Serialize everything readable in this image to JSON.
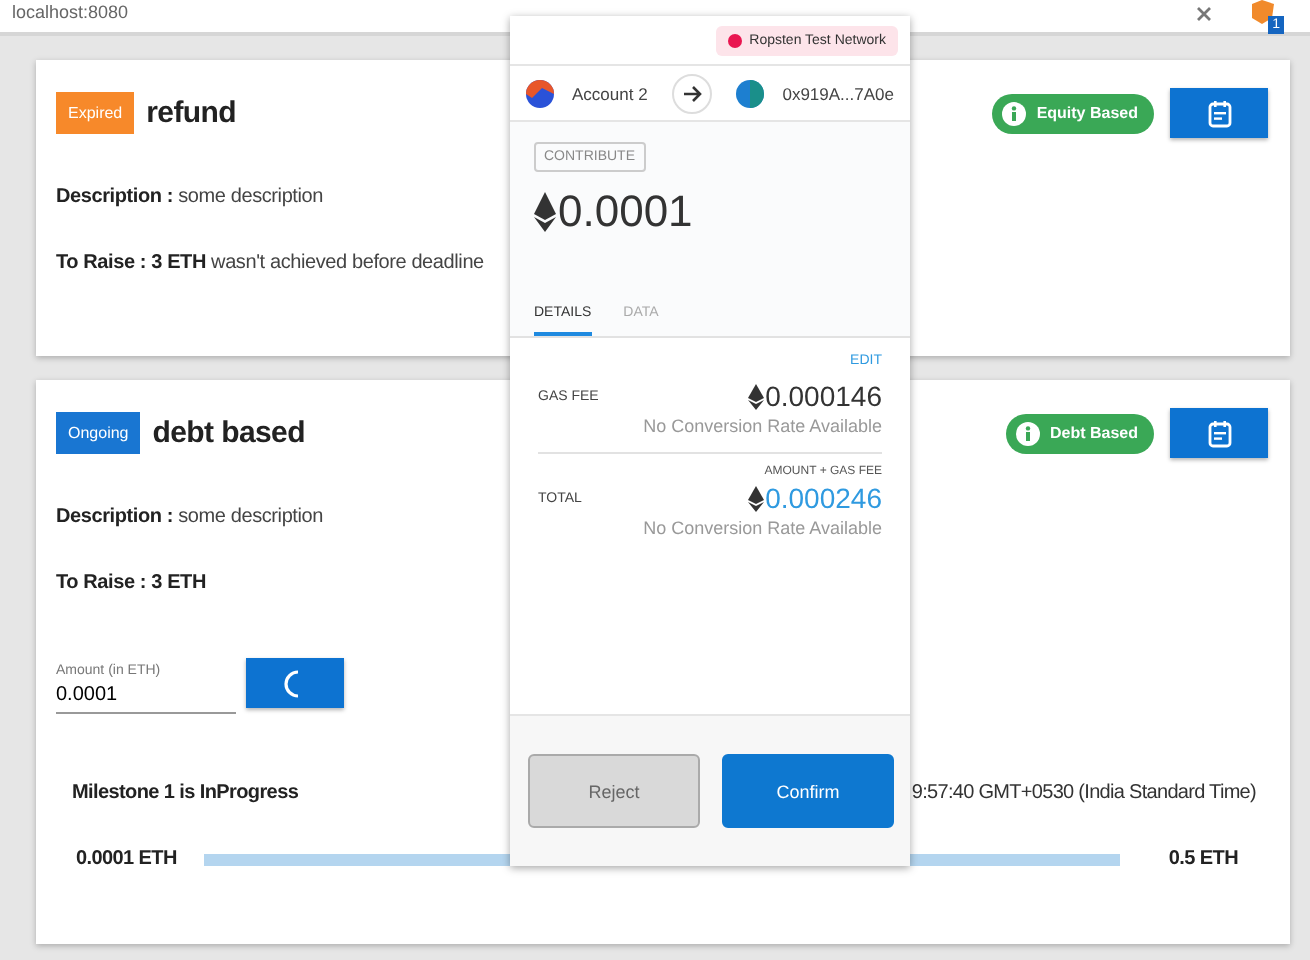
{
  "browser": {
    "url": "localhost:8080",
    "extension_badge": "1"
  },
  "campaigns": [
    {
      "status": {
        "label": "Expired",
        "kind": "expired"
      },
      "title": "refund",
      "type_chip": "Equity Based",
      "description_label": "Description :",
      "description": "some description",
      "raise_label": "To Raise : 3 ETH",
      "raise_note": "wasn't achieved before deadline"
    },
    {
      "status": {
        "label": "Ongoing",
        "kind": "ongoing"
      },
      "title": "debt based",
      "type_chip": "Debt Based",
      "description_label": "Description :",
      "description": "some description",
      "raise_label": "To Raise : 3 ETH",
      "contribute": {
        "label": "Amount (in ETH)",
        "value": "0.0001",
        "loading": true
      },
      "milestone": {
        "text": "Milestone 1 is InProgress",
        "date": "9:57:40 GMT+0530 (India Standard Time)",
        "min": "0.0001 ETH",
        "max": "0.5 ETH",
        "level": 1
      }
    }
  ],
  "confirm": {
    "network": "Ropsten Test Network",
    "from": "Account 2",
    "to": "0x919A...7A0e",
    "method": "CONTRIBUTE",
    "amount": "0.0001",
    "tabs": [
      {
        "label": "DETAILS",
        "selected": true
      },
      {
        "label": "DATA",
        "selected": false
      }
    ],
    "edit": "EDIT",
    "rows": [
      {
        "label": "GAS FEE",
        "value": "0.000146",
        "note": "No Conversion Rate Available",
        "highlight": false
      },
      {
        "label": "TOTAL",
        "caption": "AMOUNT + GAS FEE",
        "value": "0.000246",
        "note": "No Conversion Rate Available",
        "highlight": true
      }
    ],
    "buttons": [
      {
        "label": "Reject",
        "kind": "secondary"
      },
      {
        "label": "Confirm",
        "kind": "primary"
      }
    ]
  }
}
